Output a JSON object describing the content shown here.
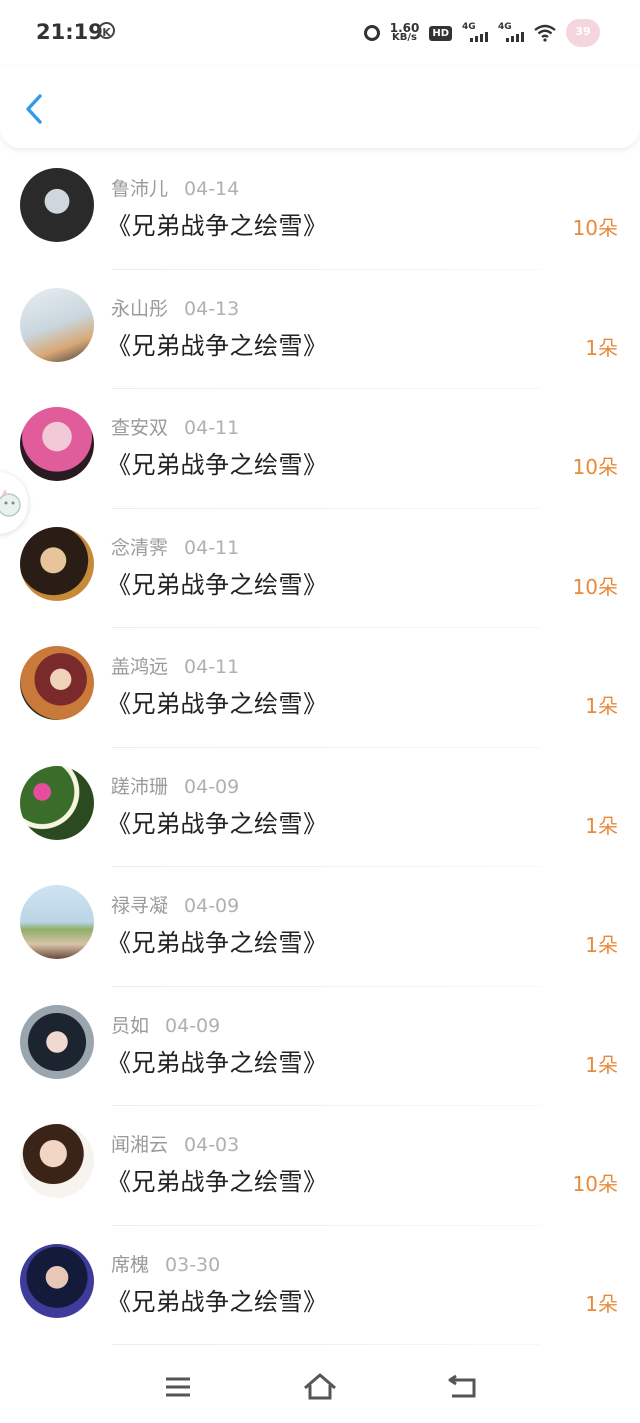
{
  "status_bar": {
    "time": "21:19",
    "k_badge": "K",
    "net_speed_value": "1.60",
    "net_speed_unit": "KB/s",
    "hd_label": "HD",
    "signal_1": "4G",
    "signal_2": "4G",
    "battery": "39"
  },
  "colors": {
    "accent_blue": "#2f9bea",
    "amount_orange": "#e98a3b"
  },
  "icons": {
    "back": "chevron-left-icon",
    "menu": "menu-icon",
    "home": "home-icon",
    "return": "return-icon"
  },
  "records": [
    {
      "name": "鲁沛儿",
      "date": "04-14",
      "title": "《兄弟战争之绘雪》",
      "amount": "10朵"
    },
    {
      "name": "永山彤",
      "date": "04-13",
      "title": "《兄弟战争之绘雪》",
      "amount": "1朵"
    },
    {
      "name": "查安双",
      "date": "04-11",
      "title": "《兄弟战争之绘雪》",
      "amount": "10朵"
    },
    {
      "name": "念清霁",
      "date": "04-11",
      "title": "《兄弟战争之绘雪》",
      "amount": "10朵"
    },
    {
      "name": "盖鸿远",
      "date": "04-11",
      "title": "《兄弟战争之绘雪》",
      "amount": "1朵"
    },
    {
      "name": "蹉沛珊",
      "date": "04-09",
      "title": "《兄弟战争之绘雪》",
      "amount": "1朵"
    },
    {
      "name": "禄寻凝",
      "date": "04-09",
      "title": "《兄弟战争之绘雪》",
      "amount": "1朵"
    },
    {
      "name": "员如",
      "date": "04-09",
      "title": "《兄弟战争之绘雪》",
      "amount": "1朵"
    },
    {
      "name": "闻湘云",
      "date": "04-03",
      "title": "《兄弟战争之绘雪》",
      "amount": "10朵"
    },
    {
      "name": "席槐",
      "date": "03-30",
      "title": "《兄弟战争之绘雪》",
      "amount": "1朵"
    }
  ]
}
